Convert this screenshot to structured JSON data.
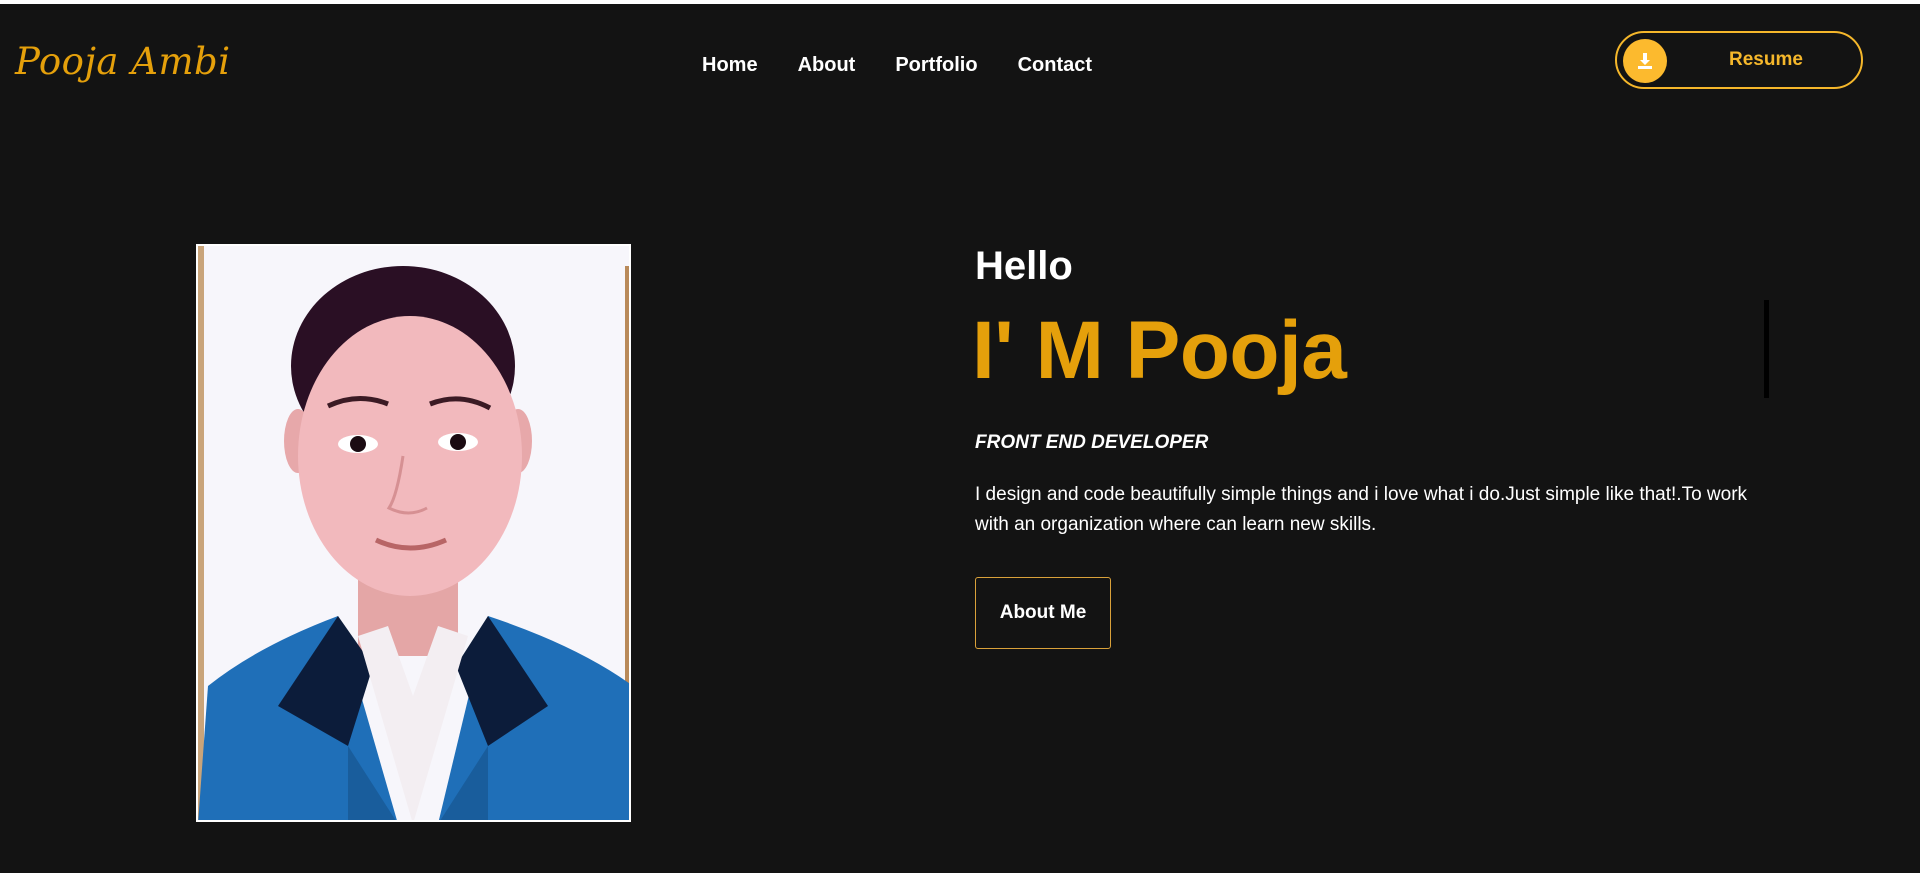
{
  "header": {
    "logo": "Pooja Ambi",
    "nav": [
      {
        "label": "Home"
      },
      {
        "label": "About"
      },
      {
        "label": "Portfolio"
      },
      {
        "label": "Contact"
      }
    ],
    "resume_button": {
      "label": "Resume",
      "icon": "download-icon"
    }
  },
  "hero": {
    "greeting": "Hello",
    "name_line": "I' M Pooja",
    "role": "FRONT END DEVELOPER",
    "description": "I design and code beautifully simple things and i love what i do.Just simple like that!.To work with an organization where can learn new skills.",
    "about_button": "About Me",
    "photo": "profile-photo"
  },
  "colors": {
    "background": "#131313",
    "accent": "#e5a00b",
    "button_accent": "#f5b72b",
    "text": "#ffffff"
  }
}
